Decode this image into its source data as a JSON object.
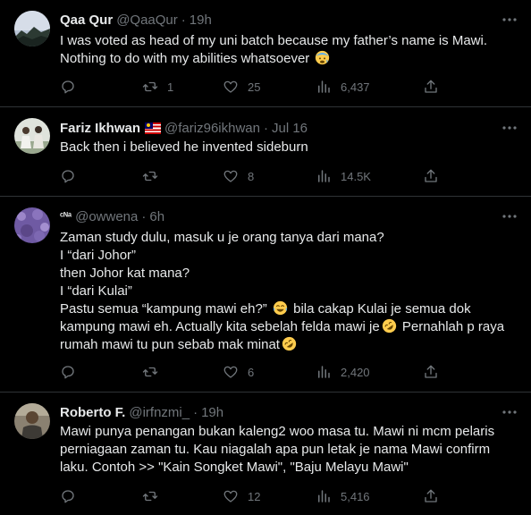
{
  "tweets": [
    {
      "name": "Qaa Qur",
      "handle": "@QaaQur",
      "time": "19h",
      "lines": [
        "I was voted as head of my uni batch because my father’s name is Mawi.",
        "Nothing to do with my abilities whatsoever"
      ],
      "replies": "",
      "retweets": "1",
      "likes": "25",
      "views": "6,437"
    },
    {
      "name": "Fariz Ikhwan",
      "handle": "@fariz96ikhwan",
      "time": "Jul 16",
      "lines": [
        "Back then i believed he invented sideburn"
      ],
      "replies": "",
      "retweets": "",
      "likes": "8",
      "views": "14.5K"
    },
    {
      "name": "ᶜᴺᵃ",
      "handle": "@owwena",
      "time": "6h",
      "lines": [
        "Zaman study dulu, masuk u je orang tanya dari mana?",
        "I “dari Johor”",
        "then Johor kat mana?",
        "I “dari Kulai”",
        "Pastu semua “kampung mawi eh?”",
        "kampung mawi eh. Actually kita sebelah felda mawi je",
        "rumah mawi tu pun sebab mak minat"
      ],
      "line5_suffix": " bila cakap Kulai je semua dok",
      "line6_suffix": " Pernahlah p raya",
      "replies": "",
      "retweets": "",
      "likes": "6",
      "views": "2,420"
    },
    {
      "name": "Roberto F.",
      "handle": "@irfnzmi_",
      "time": "19h",
      "lines": [
        "Mawi punya penangan bukan kaleng2 woo masa tu. Mawi ni mcm pelaris",
        "perniagaan zaman tu. Kau niagalah apa pun letak je nama Mawi confirm",
        "laku. Contoh >> \"Kain Songket Mawi\", \"Baju Melayu Mawi\""
      ],
      "replies": "",
      "retweets": "",
      "likes": "12",
      "views": "5,416"
    }
  ],
  "colors": {
    "background": "#000000",
    "text": "#e7e9ea",
    "muted": "#71767b",
    "divider": "#2f3336"
  },
  "icons": [
    "reply-icon",
    "retweet-icon",
    "like-icon",
    "views-icon",
    "share-icon",
    "more-icon",
    "malaysia-flag-icon",
    "cold-sweat-emoji",
    "joy-emoji",
    "rofl-emoji"
  ]
}
